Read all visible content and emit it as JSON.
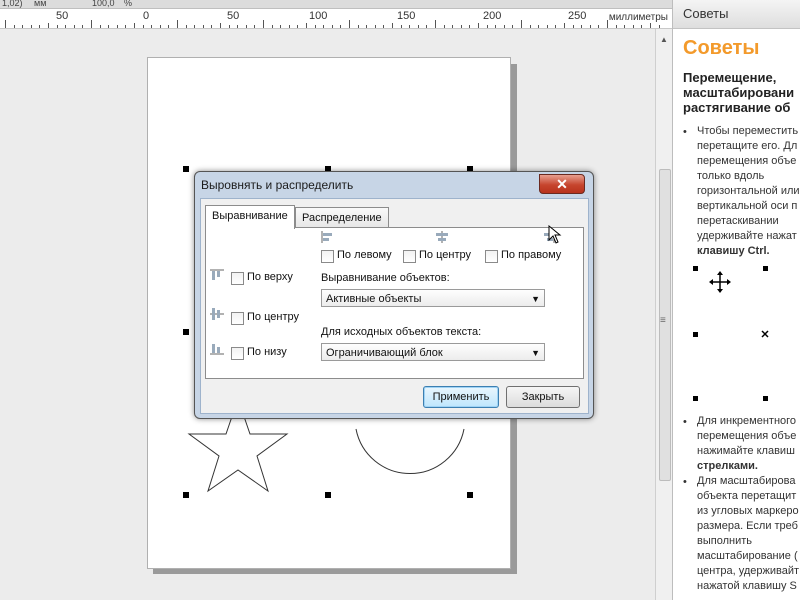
{
  "ruler": {
    "top_strip": [
      "1,02)",
      "мм",
      "100,0",
      "%"
    ],
    "ticks": [
      "50",
      "0",
      "50",
      "100",
      "150",
      "200",
      "250"
    ],
    "units": "миллиметры"
  },
  "dialog": {
    "title": "Выровнять и распределить",
    "close_symbol": "✕",
    "tabs": [
      "Выравнивание",
      "Распределение"
    ],
    "horizontal": {
      "left": "По левому",
      "center": "По центру",
      "right": "По правому"
    },
    "vertical": {
      "top": "По верху",
      "center": "По центру",
      "bottom": "По низу"
    },
    "align_objects_label": "Выравнивание объектов:",
    "align_objects_value": "Активные объекты",
    "text_source_label": "Для исходных объектов текста:",
    "text_source_value": "Ограничивающий блок",
    "apply_label": "Применить",
    "close_label": "Закрыть"
  },
  "tips": {
    "header": "Советы",
    "title": "Советы",
    "subtitle_lines": [
      "Перемещение,",
      "масштабировани",
      "растягивание об"
    ],
    "tip1_lines": [
      "Чтобы переместить",
      "перетащите его. Дл",
      "перемещения объе",
      "только вдоль",
      "горизонтальной или",
      "вертикальной оси п",
      "перетаскивании",
      "удерживайте нажат",
      "клавишу Ctrl."
    ],
    "tip2_lines": [
      "Для инкрементного",
      "перемещения объе",
      "нажимайте клавиш",
      "стрелками."
    ],
    "tip3_lines": [
      "Для масштабирова",
      "объекта перетащит",
      "из угловых маркеро",
      "размера. Если треб",
      "выполнить",
      "масштабирование (",
      "центра, удерживайт",
      "нажатой клавишу S"
    ]
  },
  "icons": {
    "close": "close-icon",
    "dropdown": "chevron-down-icon",
    "move": "move-cross-icon"
  }
}
